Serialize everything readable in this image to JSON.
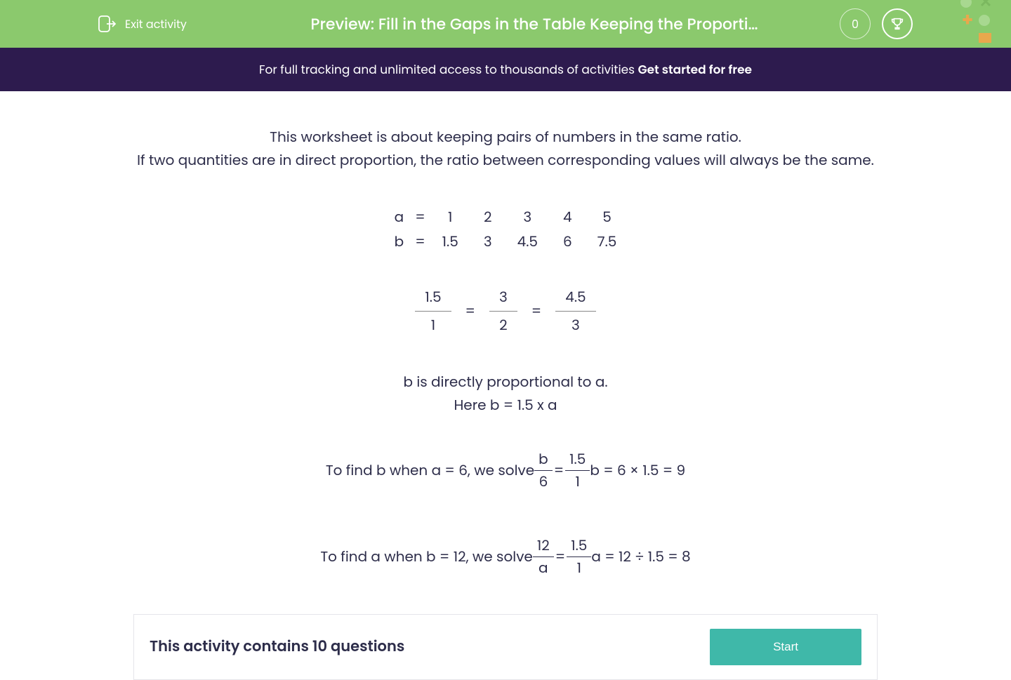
{
  "header": {
    "exit_label": "Exit activity",
    "title": "Preview: Fill in the Gaps in the Table Keeping the Proporti…",
    "score": "0"
  },
  "promo": {
    "prefix": "For full tracking and unlimited access to thousands of activities ",
    "cta": "Get started for free"
  },
  "intro": {
    "line1": "This worksheet is about keeping pairs of numbers in the same ratio.",
    "line2": "If two quantities are in direct proportion, the ratio between corresponding values will always be the same."
  },
  "ratio_table": {
    "row_a": {
      "label": "a",
      "eq": "=",
      "vals": [
        "1",
        "2",
        "3",
        "4",
        "5"
      ]
    },
    "row_b": {
      "label": "b",
      "eq": "=",
      "vals": [
        "1.5",
        "3",
        "4.5",
        "6",
        "7.5"
      ]
    }
  },
  "fractions": {
    "f1": {
      "num": "1.5",
      "den": "1"
    },
    "eq1": "=",
    "f2": {
      "num": "3",
      "den": "2"
    },
    "eq2": "=",
    "f3": {
      "num": "4.5",
      "den": "3"
    }
  },
  "mid": {
    "line1": "b is directly proportional to a.",
    "line2": "Here b = 1.5 x a"
  },
  "solve1": {
    "prefix": "To find b when a = 6, we solve",
    "fL": {
      "num": "b",
      "den": "6"
    },
    "eq": "=",
    "fR": {
      "num": "1.5",
      "den": "1"
    },
    "suffix": "b = 6 × 1.5 = 9"
  },
  "solve2": {
    "prefix": "To find a when b = 12, we solve",
    "fL": {
      "num": "12",
      "den": "a"
    },
    "eq": "=",
    "fR": {
      "num": "1.5",
      "den": "1"
    },
    "suffix": "a = 12 ÷ 1.5 = 8"
  },
  "footer": {
    "text": "This activity contains 10 questions",
    "button": "Start"
  }
}
